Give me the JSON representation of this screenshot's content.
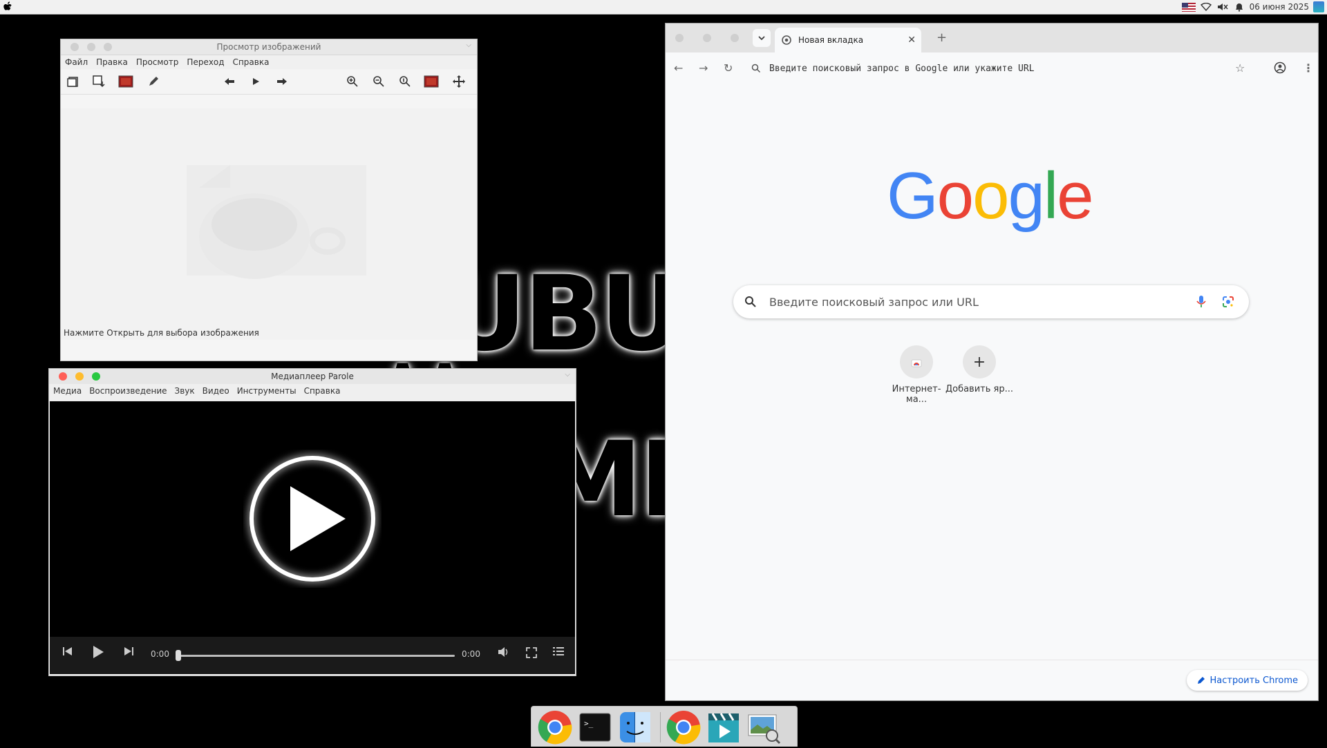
{
  "menubar": {
    "date": "06 июня 2025"
  },
  "wallpaper": {
    "text_line1": "UBU",
    "text_line2": "MI"
  },
  "viewer": {
    "title": "Просмотр изображений",
    "menu": [
      "Файл",
      "Правка",
      "Просмотр",
      "Переход",
      "Справка"
    ],
    "status": "Нажмите Открыть для выбора изображения"
  },
  "parole": {
    "title": "Медиаплеер Parole",
    "menu": [
      "Медиа",
      "Воспроизведение",
      "Звук",
      "Видео",
      "Инструменты",
      "Справка"
    ],
    "time_current": "0:00",
    "time_total": "0:00",
    "progress": 0
  },
  "chrome": {
    "tab_title": "Новая вкладка",
    "omnibox_placeholder": "Введите поисковый запрос в Google или укажите URL",
    "search_placeholder": "Введите поисковый запрос или URL",
    "shortcuts": [
      "Интернет-ма...",
      "Добавить яр..."
    ],
    "customize_label": "Настроить Chrome",
    "logo_letters": [
      "G",
      "o",
      "o",
      "g",
      "l",
      "e"
    ],
    "logo_colors": [
      "#4285F4",
      "#EA4335",
      "#FBBC05",
      "#4285F4",
      "#34A853",
      "#EA4335"
    ]
  },
  "dock": {
    "items": [
      "chrome-icon",
      "terminal-icon",
      "finder-icon",
      "chrome-icon",
      "parole-icon",
      "image-viewer-icon"
    ]
  }
}
